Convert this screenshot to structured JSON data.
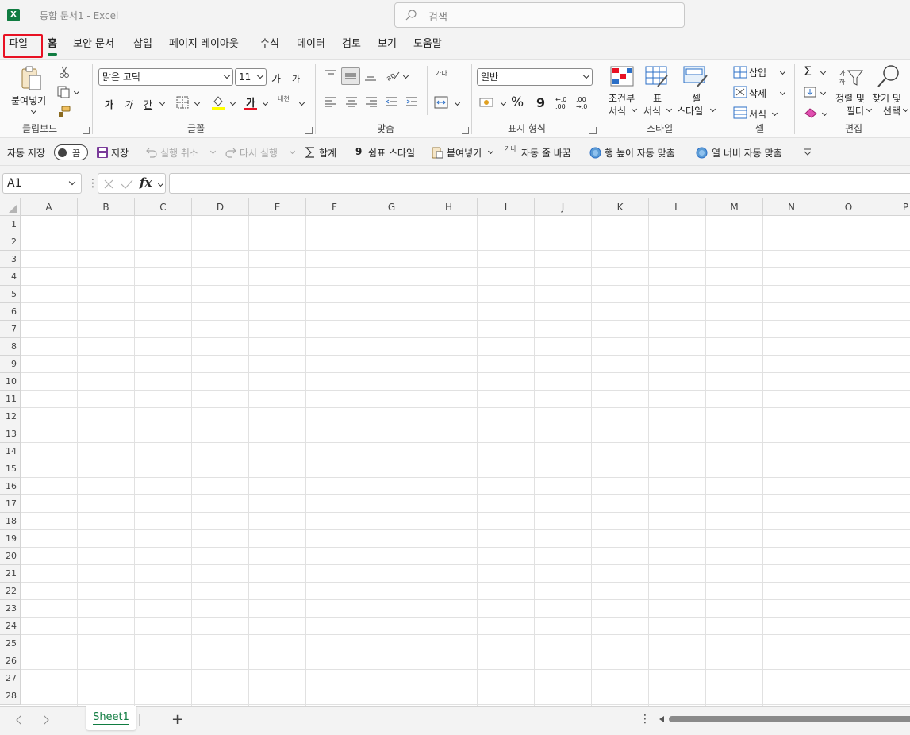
{
  "title_bar": {
    "app_icon": "X",
    "document_title": "통합 문서1  -  Excel",
    "search_placeholder": "검색"
  },
  "menu": {
    "tabs": [
      "파일",
      "홈",
      "보안 문서",
      "삽입",
      "페이지 레이아웃",
      "수식",
      "데이터",
      "검토",
      "보기",
      "도움말"
    ],
    "active_tab": "홈",
    "highlighted_tab": "파일"
  },
  "ribbon": {
    "clipboard": {
      "label": "클립보드",
      "paste": "붙여넣기"
    },
    "font": {
      "label": "글꼴",
      "font_name": "맑은 고딕",
      "font_size": "11",
      "bold": "가",
      "italic": "가",
      "underline": "간",
      "grow": "가",
      "shrink": "가",
      "font_color_glyph": "가",
      "phonetic": "내천"
    },
    "alignment": {
      "label": "맞춤",
      "wrap_glyph": "가나"
    },
    "number": {
      "label": "표시 형식",
      "format": "일반",
      "percent": "%",
      "comma": "9",
      "inc_decimal": "←.0 .00",
      "dec_decimal": ".00 →.0"
    },
    "styles": {
      "label": "스타일",
      "conditional_line1": "조건부",
      "conditional_line2": "서식",
      "table_line1": "표",
      "table_line2": "서식",
      "cell_line1": "셀",
      "cell_line2": "스타일"
    },
    "cells": {
      "label": "셀",
      "insert": "삽입",
      "delete": "삭제",
      "format": "서식"
    },
    "editing": {
      "label": "편집",
      "sum": "Σ",
      "sort_line1": "정렬 및",
      "sort_line2": "필터",
      "find_line1": "찾기 및",
      "find_line2": "선택"
    }
  },
  "quick_access": {
    "autosave": "자동 저장",
    "toggle_state": "끔",
    "save": "저장",
    "undo": "실행 취소",
    "redo": "다시 실행",
    "sum": "합계",
    "comma_style": "쉼표 스타일",
    "paste": "붙여넣기",
    "wrap_text": "자동 줄 바꿈",
    "row_autofit": "행 높이 자동 맞춤",
    "col_autofit": "열 너비 자동 맞춤",
    "wrap_glyph": "가나"
  },
  "formula_bar": {
    "name_box": "A1",
    "fx": "fx",
    "formula_value": ""
  },
  "grid": {
    "columns": [
      "A",
      "B",
      "C",
      "D",
      "E",
      "F",
      "G",
      "H",
      "I",
      "J",
      "K",
      "L",
      "M",
      "N",
      "O",
      "P"
    ],
    "rows": [
      "1",
      "2",
      "3",
      "4",
      "5",
      "6",
      "7",
      "8",
      "9",
      "10",
      "11",
      "12",
      "13",
      "14",
      "15",
      "16",
      "17",
      "18",
      "19",
      "20",
      "21",
      "22",
      "23",
      "24",
      "25",
      "26",
      "27",
      "28"
    ]
  },
  "sheet_bar": {
    "sheets": [
      "Sheet1"
    ],
    "add": "+",
    "more": "⋮"
  },
  "colors": {
    "accent": "#107c41",
    "highlight": "#e81123"
  }
}
